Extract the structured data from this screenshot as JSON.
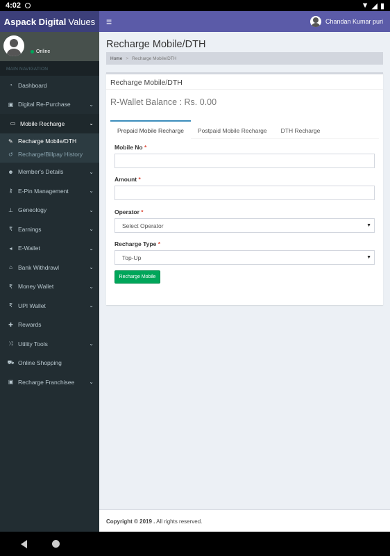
{
  "status_bar": {
    "time": "4:02"
  },
  "header": {
    "logo_bold": "Aspack Digital",
    "logo_rest": "Values",
    "user_name": "Chandan Kumar puri"
  },
  "sidebar": {
    "status": "Online",
    "nav_header": "MAIN NAVIGATION",
    "items": [
      {
        "label": "Dashboard",
        "icon": "dashboard-icon",
        "chevron": false
      },
      {
        "label": "Digital Re-Purchase",
        "icon": "briefcase-icon",
        "chevron": true
      },
      {
        "label": "Mobile Recharge",
        "icon": "battery-icon",
        "chevron": true,
        "active": true
      },
      {
        "label": "Member's Details",
        "icon": "users-icon",
        "chevron": true
      },
      {
        "label": "E-Pin Management",
        "icon": "key-icon",
        "chevron": true
      },
      {
        "label": "Geneology",
        "icon": "sitemap-icon",
        "chevron": true
      },
      {
        "label": "Earnings",
        "icon": "rupee-icon",
        "chevron": true
      },
      {
        "label": "E-Wallet",
        "icon": "wallet-icon",
        "chevron": true
      },
      {
        "label": "Bank Withdrawl",
        "icon": "bank-icon",
        "chevron": true
      },
      {
        "label": "Money Wallet",
        "icon": "rupee-icon",
        "chevron": true
      },
      {
        "label": "UPI Wallet",
        "icon": "rupee-icon",
        "chevron": true
      },
      {
        "label": "Rewards",
        "icon": "gift-icon",
        "chevron": false
      },
      {
        "label": "Utility Tools",
        "icon": "shuffle-icon",
        "chevron": true
      },
      {
        "label": "Online Shopping",
        "icon": "cart-icon",
        "chevron": false
      },
      {
        "label": "Recharge Franchisee",
        "icon": "briefcase-icon",
        "chevron": true
      }
    ],
    "submenu": [
      {
        "label": "Recharge Mobile/DTH",
        "icon": "leaf-icon",
        "active": true
      },
      {
        "label": "Recharge/Billpay History",
        "icon": "history-icon",
        "active": false
      }
    ]
  },
  "content": {
    "page_title": "Recharge Mobile/DTH",
    "breadcrumb": {
      "home": "Home",
      "current": "Recharge Mobile/DTH"
    },
    "box_title": "Recharge Mobile/DTH",
    "wallet_balance": "R-Wallet Balance : Rs. 0.00",
    "tabs": [
      "Prepaid Mobile Recharge",
      "Postpaid Mobile Recharge",
      "DTH Recharge"
    ],
    "form": {
      "mobile_label": "Mobile No",
      "mobile_value": "",
      "amount_label": "Amount",
      "amount_value": "",
      "operator_label": "Operator",
      "operator_value": "Select Operator",
      "type_label": "Recharge Type",
      "type_value": "Top-Up",
      "required_mark": "*",
      "submit_label": "Recharge Mobile"
    }
  },
  "footer": {
    "copyright": "Copyright © 2019 .",
    "rights": "All rights reserved."
  },
  "colors": {
    "header": "#5b5ba8",
    "logo_bg": "#3c3f7a",
    "sidebar": "#222d32",
    "button": "#00a65a",
    "tab_active": "#3c8dbc"
  }
}
